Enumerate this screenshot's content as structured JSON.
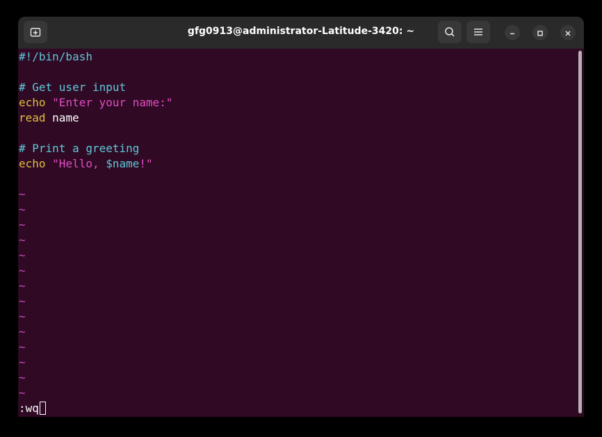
{
  "window": {
    "title": "gfg0913@administrator-Latitude-3420: ~",
    "buttons": {
      "new_tab_icon": "new-tab-icon",
      "search_icon": "search-icon",
      "menu_icon": "hamburger-menu-icon",
      "minimize_icon": "minimize-icon",
      "maximize_icon": "maximize-icon",
      "close_icon": "close-icon"
    }
  },
  "editor": {
    "lines": {
      "shebang": "#!/bin/bash",
      "comment1": "# Get user input",
      "echo1_kw": "echo",
      "echo1_str": "\"Enter your name:\"",
      "read_kw": "read",
      "read_arg": "name",
      "comment2": "# Print a greeting",
      "echo2_kw": "echo",
      "echo2_str_open": "\"Hello, ",
      "echo2_var": "$name",
      "echo2_str_close": "!\""
    },
    "tilde": "~",
    "command": ":wq"
  },
  "colors": {
    "background": "#300a24",
    "titlebar": "#2a2a2a",
    "comment": "#5fc7d9",
    "keyword": "#e0be3f",
    "string": "#e14ec2",
    "tilde": "#c74bbf"
  }
}
